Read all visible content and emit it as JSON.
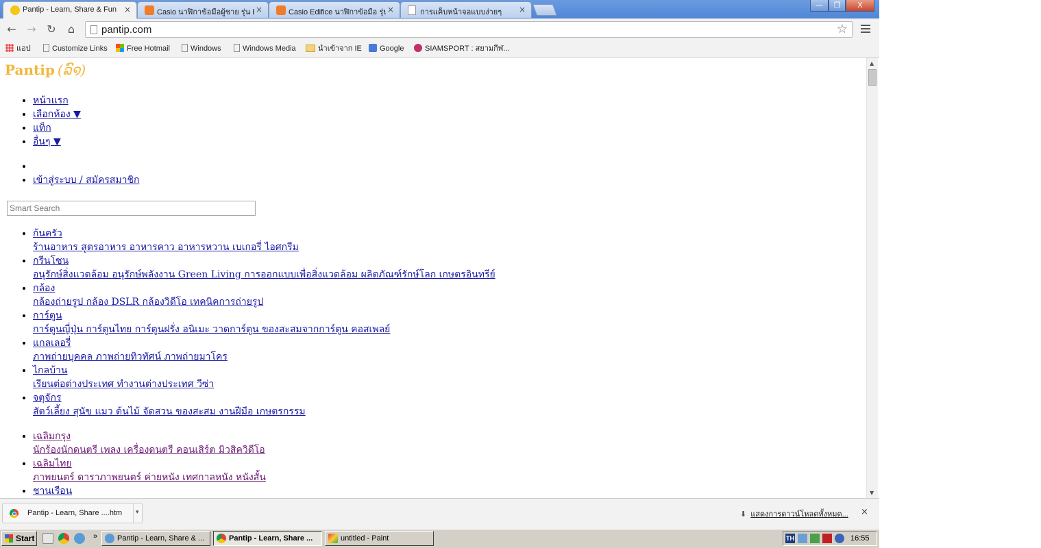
{
  "browser": {
    "tabs": [
      {
        "title": "Pantip - Learn, Share & Fun",
        "active": true
      },
      {
        "title": "Casio นาฬิกาข้อมือผู้ชาย รุ่น Ed",
        "active": false
      },
      {
        "title": "Casio Edifice นาฬิกาข้อมือ รุ่น",
        "active": false
      },
      {
        "title": "การแค็บหน้าจอแบบง่ายๆ",
        "active": false
      }
    ],
    "tab_close_glyph": "×",
    "window_controls": {
      "minimize": "—",
      "restore": "❐",
      "close": "X"
    },
    "url": "pantip.com",
    "bookmarks": [
      {
        "label": "แอป",
        "icon": "apps-grid-icon"
      },
      {
        "label": "Customize Links",
        "icon": "page-icon"
      },
      {
        "label": "Free Hotmail",
        "icon": "windows-logo-icon"
      },
      {
        "label": "Windows",
        "icon": "page-icon"
      },
      {
        "label": "Windows Media",
        "icon": "page-icon"
      },
      {
        "label": "นำเข้าจาก IE",
        "icon": "folder-icon"
      },
      {
        "label": "Google",
        "icon": "google-icon"
      },
      {
        "label": "SIAMSPORT : สยามกีฬ...",
        "icon": "siamsport-icon"
      }
    ]
  },
  "page": {
    "logo": {
      "text": "Pantip",
      "mark": "(ລົ໑)"
    },
    "nav": [
      {
        "label": "หน้าแรก"
      },
      {
        "label": "เลือกห้อง ▼"
      },
      {
        "label": "แท็ก"
      },
      {
        "label": "อื่นๆ ▼"
      }
    ],
    "nav2": [
      {
        "label": ""
      },
      {
        "label": "เข้าสู่ระบบ / สมัครสมาชิก"
      }
    ],
    "search": {
      "placeholder": "Smart Search"
    },
    "rooms": [
      {
        "name": "ก้นครัว",
        "desc": "ร้านอาหาร สูตรอาหาร อาหารคาว อาหารหวาน เบเกอรี่ ไอศกรีม",
        "visited": false
      },
      {
        "name": "กรีนโซน",
        "desc": "อนุรักษ์สิ่งแวดล้อม อนุรักษ์พลังงาน Green Living การออกแบบเพื่อสิ่งแวดล้อม ผลิตภัณฑ์รักษ์โลก เกษตรอินทรีย์",
        "visited": false
      },
      {
        "name": "กล้อง",
        "desc": "กล้องถ่ายรูป กล้อง DSLR กล้องวิดีโอ เทคนิคการถ่ายรูป",
        "visited": false
      },
      {
        "name": "การ์ตูน",
        "desc": "การ์ตูนญี่ปุ่น การ์ตูนไทย การ์ตูนฝรั่ง อนิเมะ วาดการ์ตูน ของสะสมจากการ์ตูน คอสเพลย์",
        "visited": false
      },
      {
        "name": "แกลเลอรี่",
        "desc": "ภาพถ่ายบุคคล ภาพถ่ายทิวทัศน์ ภาพถ่ายมาโคร",
        "visited": false
      },
      {
        "name": "ไกลบ้าน",
        "desc": "เรียนต่อต่างประเทศ ทำงานต่างประเทศ วีซ่า",
        "visited": false
      },
      {
        "name": "จตุจักร",
        "desc": "สัตว์เลี้ยง สุนัข แมว ต้นไม้ จัดสวน ของสะสม งานฝีมือ เกษตรกรรม",
        "visited": false
      },
      {
        "name": "เฉลิมกรุง",
        "desc": "นักร้องนักดนตรี เพลง เครื่องดนตรี คอนเสิร์ต มิวสิควิดีโอ",
        "visited": true
      },
      {
        "name": "เฉลิมไทย",
        "desc": "ภาพยนตร์ ดาราภาพยนตร์ ค่ายหนัง เทศกาลหนัง หนังสั้น",
        "visited": true
      },
      {
        "name": "ชานเรือน",
        "desc": "",
        "visited": false
      }
    ]
  },
  "download_shelf": {
    "item": "Pantip - Learn, Share ....htm",
    "dropdown": "▾",
    "show_all": "แสดงการดาวน์โหลดทั้งหมด...",
    "close": "×"
  },
  "taskbar": {
    "start": "Start",
    "more": "»",
    "buttons": [
      {
        "label": "Pantip - Learn, Share & ...",
        "active": false
      },
      {
        "label": "Pantip - Learn, Share ...",
        "active": true
      },
      {
        "label": "untitled - Paint",
        "active": false
      }
    ],
    "tray": {
      "lang": "TH",
      "clock": "16:55"
    }
  }
}
